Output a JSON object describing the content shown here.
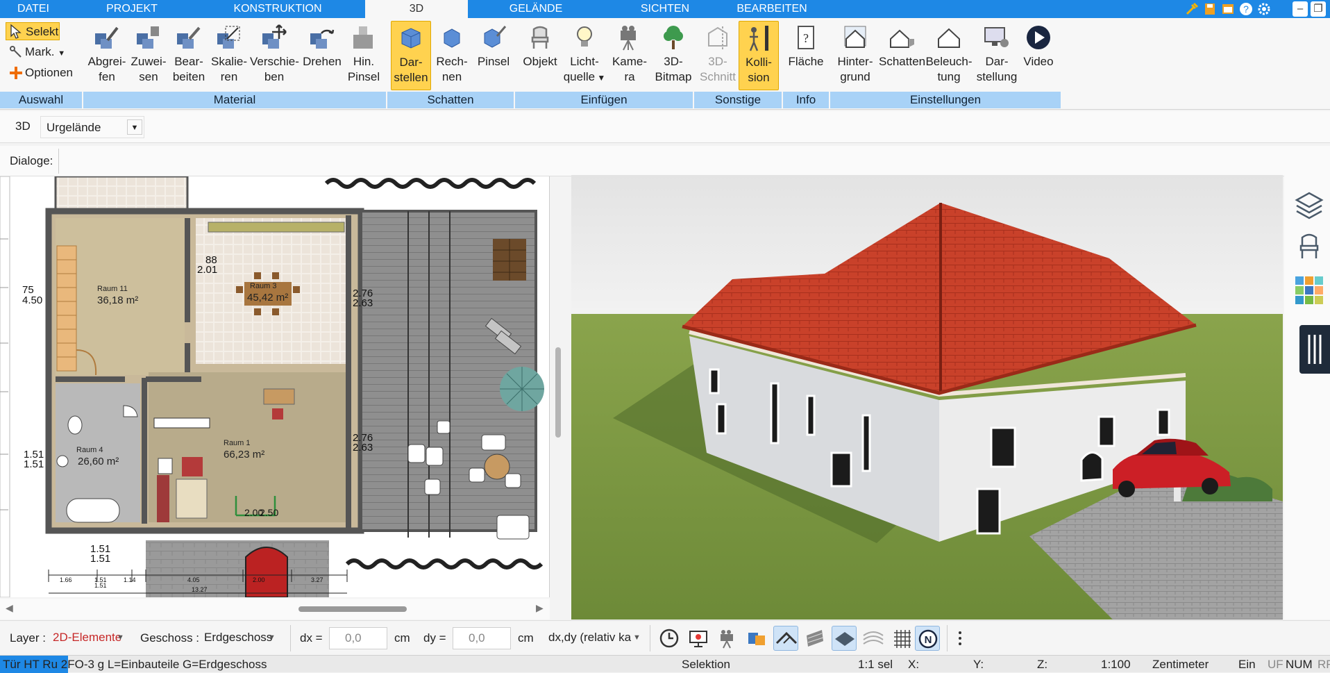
{
  "tabs": [
    {
      "label": "DATEI"
    },
    {
      "label": "PROJEKT"
    },
    {
      "label": "KONSTRUKTION"
    },
    {
      "label": "3D"
    },
    {
      "label": "GELÄNDE"
    },
    {
      "label": "SICHTEN"
    },
    {
      "label": "BEARBEITEN"
    }
  ],
  "ribbon": {
    "auswahl": {
      "select": "Selekt",
      "mark": "Mark.",
      "options": "Optionen",
      "group": "Auswahl"
    },
    "material": {
      "group": "Material",
      "buttons": [
        {
          "line1": "Abgrei-",
          "line2": "fen"
        },
        {
          "line1": "Zuwei-",
          "line2": "sen"
        },
        {
          "line1": "Bear-",
          "line2": "beiten"
        },
        {
          "line1": "Skalie-",
          "line2": "ren"
        },
        {
          "line1": "Verschie-",
          "line2": "ben"
        },
        {
          "line1": "Drehen",
          "line2": ""
        },
        {
          "line1": "Hin.",
          "line2": "Pinsel"
        }
      ]
    },
    "schatten": {
      "group": "Schatten",
      "buttons": [
        {
          "line1": "Dar-",
          "line2": "stellen"
        },
        {
          "line1": "Rech-",
          "line2": "nen"
        },
        {
          "line1": "Pinsel",
          "line2": ""
        }
      ]
    },
    "einfuegen": {
      "group": "Einfügen",
      "buttons": [
        {
          "line1": "Objekt",
          "line2": ""
        },
        {
          "line1": "Licht-",
          "line2": "quelle"
        },
        {
          "line1": "Kame-",
          "line2": "ra"
        },
        {
          "line1": "3D-",
          "line2": "Bitmap"
        }
      ]
    },
    "sonstige": {
      "group": "Sonstige",
      "buttons": [
        {
          "line1": "3D-",
          "line2": "Schnitt"
        },
        {
          "line1": "Kolli-",
          "line2": "sion"
        }
      ]
    },
    "info": {
      "group": "Info",
      "buttons": [
        {
          "line1": "Fläche",
          "line2": ""
        }
      ]
    },
    "einstellungen": {
      "group": "Einstellungen",
      "buttons": [
        {
          "line1": "Hinter-",
          "line2": "grund"
        },
        {
          "line1": "Schatten",
          "line2": ""
        },
        {
          "line1": "Beleuch-",
          "line2": "tung"
        },
        {
          "line1": "Dar-",
          "line2": "stellung"
        },
        {
          "line1": "Video",
          "line2": ""
        }
      ]
    }
  },
  "view_row": {
    "label": "3D",
    "selected": "Urgelände"
  },
  "dialog_row": {
    "label": "Dialoge:"
  },
  "plan": {
    "rooms": [
      {
        "name": "Raum 11",
        "area": "36,18 m²"
      },
      {
        "name": "Raum 3",
        "area": "45,42 m²"
      },
      {
        "name": "Raum 4",
        "area": "26,60 m²"
      },
      {
        "name": "Raum 1",
        "area": "66,23 m²"
      }
    ],
    "dims": [
      "75",
      "4.50",
      "1.51",
      "1.51",
      "1.51",
      "1.51",
      "88",
      "2.01",
      "88",
      "2.01",
      "88",
      "2.01",
      "2.76",
      "2.63",
      "2.76",
      "2.63",
      "2.00",
      "2.50"
    ],
    "bottom_ruler": [
      "1.66",
      "1.51",
      "1.51",
      "1.14",
      "4.05",
      "2.00",
      "3.27",
      "13.27"
    ]
  },
  "bottom": {
    "layer_label": "Layer :",
    "layer_value": "2D-Elemente",
    "geschoss_label": "Geschoss :",
    "geschoss_value": "Erdgeschoss",
    "dx_label": "dx =",
    "dx_value": "0,0",
    "dx_unit": "cm",
    "dy_label": "dy =",
    "dy_value": "0,0",
    "dy_unit": "cm",
    "mode_value": "dx,dy (relativ ka"
  },
  "status": {
    "left": "Tür HT  Ru 2FO-3 g L=Einbauteile G=Erdgeschoss",
    "selektion": "Selektion",
    "scale_sel": "1:1 sel",
    "x": "X:",
    "y": "Y:",
    "z": "Z:",
    "scale": "1:100",
    "unit": "Zentimeter",
    "ein": "Ein",
    "uf": "UF",
    "num": "NUM",
    "rf": "RF"
  },
  "colors": {
    "tabbar": "#1e88e5",
    "group_band": "#a8d2f7",
    "active_button": "#ffd24f",
    "roof": "#c9412a",
    "grass": "#7c9a44",
    "car": "#cc1f26"
  }
}
